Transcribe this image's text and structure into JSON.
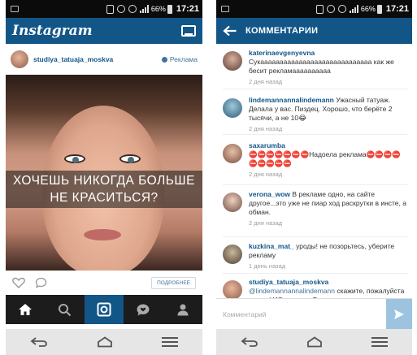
{
  "status_bar": {
    "battery": "66%",
    "time": "17:21"
  },
  "colors": {
    "brand": "#125688",
    "link": "#3f729b",
    "tab_active": "#125688",
    "send": "#9cc3e0"
  },
  "feed": {
    "app_title": "Instagram",
    "inbox_icon": "inbox-icon",
    "post": {
      "username": "studiya_tatuaja_moskva",
      "sponsored_label": "Реклама",
      "image_caption": "ХОЧЕШЬ НИКОГДА БОЛЬШЕ НЕ КРАСИТЬСЯ?",
      "learn_more": "ПОДРОБНЕЕ"
    },
    "tabs": [
      "home-icon",
      "search-icon",
      "camera-icon",
      "activity-icon",
      "profile-icon"
    ]
  },
  "comments_screen": {
    "title": "КОММЕНТАРИИ",
    "input_placeholder": "Комментарий",
    "comments": [
      {
        "user": "katerinaevgenyevna",
        "text": "Сукааааааааааааааааааааааааааааа как же бесит рекламаааааааааа",
        "time": "2 дня назад"
      },
      {
        "user": "lindemannannalindemann",
        "text": "Ужасный татуаж. Делала у вас. Пиздец. Хорошо, что берёте 2 тысячи, а не 10😂",
        "time": "2 дня назад"
      },
      {
        "user": "saxarumba",
        "text": "⛔⛔⛔⛔⛔⛔⛔Надоела реклама⛔⛔⛔⛔⛔⛔⛔⛔⛔",
        "time": "2 дня назад"
      },
      {
        "user": "verona_wow",
        "text": "В рекламе одно, на сайте другое...это уже не пиар ход раскрутки в инсте, а обман.",
        "time": "2 дня назад"
      },
      {
        "user": "kuzkina_mat_",
        "text": "уроды! не позорьтесь, уберите рекламу",
        "time": "1 день назад"
      },
      {
        "user": "studiya_tatuaja_moskva",
        "mention": "@lindemannannalindemann",
        "text": "скажите, пожалуйста ваше ФИО и номер Вы",
        "time": ""
      }
    ]
  }
}
